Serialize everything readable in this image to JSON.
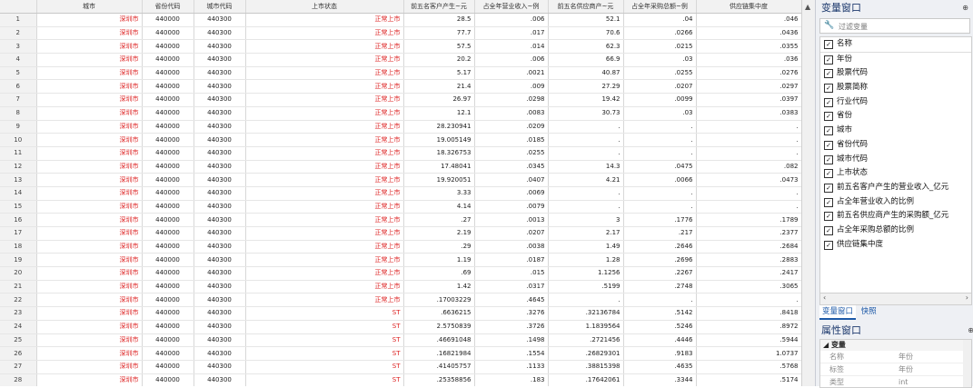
{
  "grid": {
    "columns": [
      "城市",
      "省份代码",
      "城市代码",
      "上市状态",
      "前五名客户产生~元",
      "占全年营业收入~例",
      "前五名供应商产~元",
      "占全年采购总额~例",
      "供应链集中度"
    ],
    "rows": [
      [
        "1",
        "深圳市",
        "440000",
        "440300",
        "正常上市",
        "28.5",
        ".006",
        "52.1",
        ".04",
        ".046"
      ],
      [
        "2",
        "深圳市",
        "440000",
        "440300",
        "正常上市",
        "77.7",
        ".017",
        "70.6",
        ".0266",
        ".0436"
      ],
      [
        "3",
        "深圳市",
        "440000",
        "440300",
        "正常上市",
        "57.5",
        ".014",
        "62.3",
        ".0215",
        ".0355"
      ],
      [
        "4",
        "深圳市",
        "440000",
        "440300",
        "正常上市",
        "20.2",
        ".006",
        "66.9",
        ".03",
        ".036"
      ],
      [
        "5",
        "深圳市",
        "440000",
        "440300",
        "正常上市",
        "5.17",
        ".0021",
        "40.87",
        ".0255",
        ".0276"
      ],
      [
        "6",
        "深圳市",
        "440000",
        "440300",
        "正常上市",
        "21.4",
        ".009",
        "27.29",
        ".0207",
        ".0297"
      ],
      [
        "7",
        "深圳市",
        "440000",
        "440300",
        "正常上市",
        "26.97",
        ".0298",
        "19.42",
        ".0099",
        ".0397"
      ],
      [
        "8",
        "深圳市",
        "440000",
        "440300",
        "正常上市",
        "12.1",
        ".0083",
        "30.73",
        ".03",
        ".0383"
      ],
      [
        "9",
        "深圳市",
        "440000",
        "440300",
        "正常上市",
        "28.230941",
        ".0209",
        ".",
        ".",
        "."
      ],
      [
        "10",
        "深圳市",
        "440000",
        "440300",
        "正常上市",
        "19.005149",
        ".0185",
        ".",
        ".",
        "."
      ],
      [
        "11",
        "深圳市",
        "440000",
        "440300",
        "正常上市",
        "18.326753",
        ".0255",
        ".",
        ".",
        "."
      ],
      [
        "12",
        "深圳市",
        "440000",
        "440300",
        "正常上市",
        "17.48041",
        ".0345",
        "14.3",
        ".0475",
        ".082"
      ],
      [
        "13",
        "深圳市",
        "440000",
        "440300",
        "正常上市",
        "19.920051",
        ".0407",
        "4.21",
        ".0066",
        ".0473"
      ],
      [
        "14",
        "深圳市",
        "440000",
        "440300",
        "正常上市",
        "3.33",
        ".0069",
        ".",
        ".",
        "."
      ],
      [
        "15",
        "深圳市",
        "440000",
        "440300",
        "正常上市",
        "4.14",
        ".0079",
        ".",
        ".",
        "."
      ],
      [
        "16",
        "深圳市",
        "440000",
        "440300",
        "正常上市",
        ".27",
        ".0013",
        "3",
        ".1776",
        ".1789"
      ],
      [
        "17",
        "深圳市",
        "440000",
        "440300",
        "正常上市",
        "2.19",
        ".0207",
        "2.17",
        ".217",
        ".2377"
      ],
      [
        "18",
        "深圳市",
        "440000",
        "440300",
        "正常上市",
        ".29",
        ".0038",
        "1.49",
        ".2646",
        ".2684"
      ],
      [
        "19",
        "深圳市",
        "440000",
        "440300",
        "正常上市",
        "1.19",
        ".0187",
        "1.28",
        ".2696",
        ".2883"
      ],
      [
        "20",
        "深圳市",
        "440000",
        "440300",
        "正常上市",
        ".69",
        ".015",
        "1.1256",
        ".2267",
        ".2417"
      ],
      [
        "21",
        "深圳市",
        "440000",
        "440300",
        "正常上市",
        "1.42",
        ".0317",
        ".5199",
        ".2748",
        ".3065"
      ],
      [
        "22",
        "深圳市",
        "440000",
        "440300",
        "正常上市",
        ".17003229",
        ".4645",
        ".",
        ".",
        "."
      ],
      [
        "23",
        "深圳市",
        "440000",
        "440300",
        "ST",
        ".6636215",
        ".3276",
        ".32136784",
        ".5142",
        ".8418"
      ],
      [
        "24",
        "深圳市",
        "440000",
        "440300",
        "ST",
        "2.5750839",
        ".3726",
        "1.1839564",
        ".5246",
        ".8972"
      ],
      [
        "25",
        "深圳市",
        "440000",
        "440300",
        "ST",
        ".46691048",
        ".1498",
        ".2721456",
        ".4446",
        ".5944"
      ],
      [
        "26",
        "深圳市",
        "440000",
        "440300",
        "ST",
        ".16821984",
        ".1554",
        ".26829301",
        ".9183",
        "1.0737"
      ],
      [
        "27",
        "深圳市",
        "440000",
        "440300",
        "ST",
        ".41405757",
        ".1133",
        ".38815398",
        ".4635",
        ".5768"
      ],
      [
        "28",
        "深圳市",
        "440000",
        "440300",
        "ST",
        ".25358856",
        ".183",
        ".17642061",
        ".3344",
        ".5174"
      ],
      [
        "29",
        "深圳市",
        "440000",
        "440300",
        "ST",
        ".25826058",
        ".0898",
        ".34339558",
        ".3693",
        ".4591"
      ]
    ]
  },
  "var_window": {
    "title": "变量窗口",
    "pin": "⊕",
    "filter_placeholder": "过滤变量",
    "name_header": "名称",
    "items": [
      "年份",
      "股票代码",
      "股票简称",
      "行业代码",
      "省份",
      "城市",
      "省份代码",
      "城市代码",
      "上市状态",
      "前五名客户产生的营业收入_亿元",
      "占全年营业收入的比例",
      "前五名供应商产生的采购额_亿元",
      "占全年采购总额的比例",
      "供应链集中度"
    ],
    "tab_vars": "变量窗口",
    "tab_snap": "快照"
  },
  "prop_window": {
    "title": "属性窗口",
    "section": "变量",
    "rows": [
      {
        "k": "名称",
        "v": "年份"
      },
      {
        "k": "标签",
        "v": "年份"
      },
      {
        "k": "类型",
        "v": "int"
      }
    ]
  },
  "colors": {
    "red_text": "#dd2222",
    "accent": "#1e5aa8"
  }
}
